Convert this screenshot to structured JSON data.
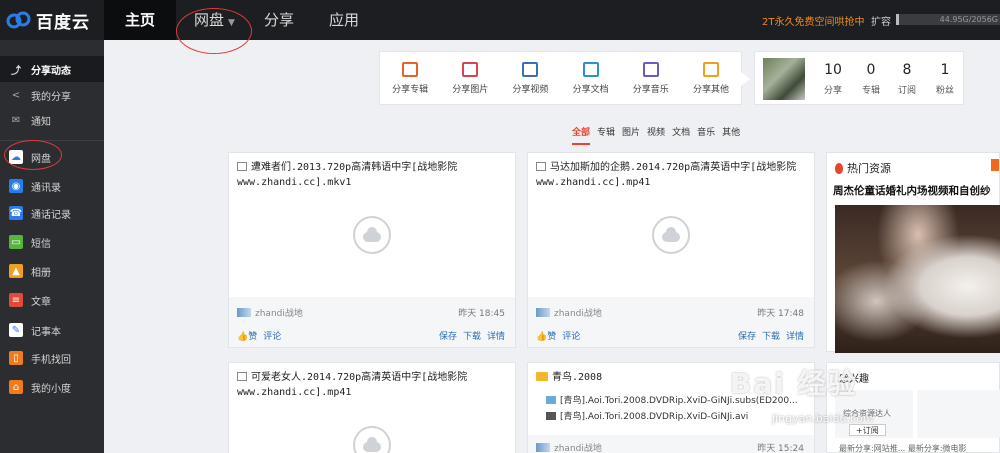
{
  "app": {
    "logo_text": "百度云"
  },
  "topnav": [
    {
      "label": "主页"
    },
    {
      "label": "网盘"
    },
    {
      "label": "分享"
    },
    {
      "label": "应用"
    }
  ],
  "header": {
    "promo": "2T永久免费空间哄抢中",
    "expand": "扩容",
    "quota": "44.95G/2056G"
  },
  "sidebar": {
    "items": [
      {
        "label": "分享动态"
      },
      {
        "label": "我的分享"
      },
      {
        "label": "通知"
      },
      {
        "label": "网盘"
      },
      {
        "label": "通讯录"
      },
      {
        "label": "通话记录"
      },
      {
        "label": "短信"
      },
      {
        "label": "相册"
      },
      {
        "label": "文章"
      },
      {
        "label": "记事本"
      },
      {
        "label": "手机找回"
      },
      {
        "label": "我的小度"
      }
    ]
  },
  "share_toolbar": [
    {
      "label": "分享专辑",
      "color": "#e6622d"
    },
    {
      "label": "分享图片",
      "color": "#d9434b"
    },
    {
      "label": "分享视频",
      "color": "#3b6fb6"
    },
    {
      "label": "分享文档",
      "color": "#2f8fd1"
    },
    {
      "label": "分享音乐",
      "color": "#6a5bc2"
    },
    {
      "label": "分享其他",
      "color": "#f0a020"
    }
  ],
  "profile": {
    "stats": [
      {
        "num": "10",
        "label": "分享"
      },
      {
        "num": "0",
        "label": "专辑"
      },
      {
        "num": "8",
        "label": "订阅"
      },
      {
        "num": "1",
        "label": "粉丝"
      }
    ]
  },
  "filters": [
    "全部",
    "专辑",
    "图片",
    "视频",
    "文档",
    "音乐",
    "其他"
  ],
  "cards": [
    {
      "title": "遭难者们.2013.720p高清韩语中字[战地影院 www.zhandi.cc].mkv1",
      "user": "zhandi战地",
      "time": "昨天 18:45"
    },
    {
      "title": "马达加斯加的企鹅.2014.720p高清英语中字[战地影院 www.zhandi.cc].mp41",
      "user": "zhandi战地",
      "time": "昨天 17:48"
    },
    {
      "title": "可爱老女人.2014.720p高清英语中字[战地影院 www.zhandi.cc].mp41"
    },
    {
      "title": "青鸟.2008",
      "files": [
        "[青鸟].Aoi.Tori.2008.DVDRip.XviD-GiNJi.subs(ED200...",
        "[青鸟].Aoi.Tori.2008.DVDRip.XviD-GiNJi.avi"
      ],
      "user": "zhandi战地",
      "time": "昨天 15:24"
    }
  ],
  "card_actions": {
    "like": "赞",
    "comment": "评论",
    "save": "保存",
    "download": "下载",
    "detail": "详情"
  },
  "hot": {
    "title": "热门资源",
    "headline": "周杰伦童话婚礼内场视频和自创纱"
  },
  "recommend": {
    "title": "感兴趣",
    "user_label": "综合资源达人",
    "subscribe": "+订阅",
    "footer": "最新分享:网站推... 最新分享:微电影"
  },
  "watermark": {
    "text": "Bai 经验",
    "url": "jingyan.baidu.com"
  }
}
